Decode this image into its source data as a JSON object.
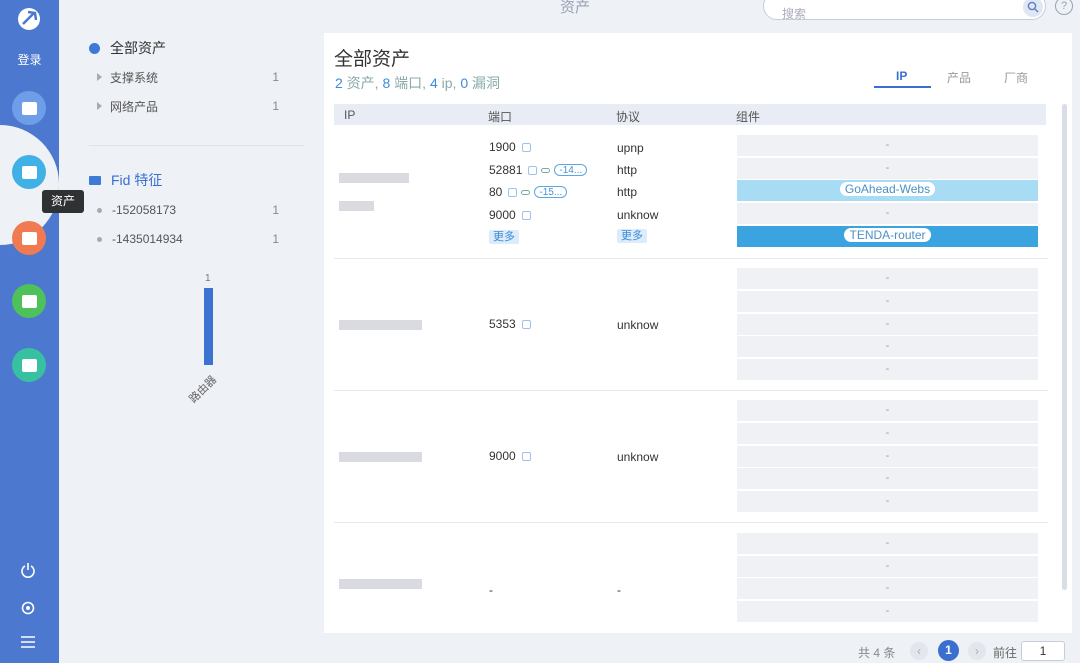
{
  "rail": {
    "login_label": "登录",
    "tooltip": "资产",
    "items": [
      {
        "name": "dashboard",
        "color": "#6f9ee8"
      },
      {
        "name": "assets",
        "color": "#3fb1e6"
      },
      {
        "name": "report",
        "color": "#f07a52"
      },
      {
        "name": "chart",
        "color": "#4fc15a"
      },
      {
        "name": "plugin",
        "color": "#38c1a0"
      }
    ]
  },
  "topbar": {
    "title": "资产",
    "search_placeholder": "搜索",
    "help": "?"
  },
  "tree": {
    "all_assets": "全部资产",
    "sections": [
      {
        "label": "支撑系统",
        "count": "1"
      },
      {
        "label": "网络产品",
        "count": "1"
      }
    ],
    "fid_title": "Fid 特征",
    "fids": [
      {
        "label": "-152058173",
        "count": "1"
      },
      {
        "label": "-1435014934",
        "count": "1"
      }
    ]
  },
  "chart_data": {
    "type": "bar",
    "categories": [
      "路由器"
    ],
    "values": [
      1
    ],
    "data_labels": [
      "1"
    ]
  },
  "panel": {
    "title": "全部资产",
    "stats": {
      "assets": "2",
      "assets_label": " 资产, ",
      "ports": "8",
      "ports_label": " 端口, ",
      "ips": "4",
      "ips_label": " ip, ",
      "vulns": "0",
      "vulns_label": " 漏洞"
    },
    "tabs": [
      "IP",
      "产品",
      "厂商"
    ],
    "columns": [
      "IP",
      "端口",
      "协议",
      "组件"
    ],
    "groups": [
      {
        "ports": [
          {
            "port": "1900",
            "link": false,
            "pill": ""
          },
          {
            "port": "52881",
            "link": true,
            "pill": "-14..."
          },
          {
            "port": "80",
            "link": true,
            "pill": "-15..."
          },
          {
            "port": "9000",
            "link": false,
            "pill": ""
          }
        ],
        "protocols": [
          "upnp",
          "http",
          "http",
          "unknow"
        ],
        "more_port": "更多",
        "more_proto": "更多",
        "components": [
          "-",
          "-",
          "GoAhead-Webs",
          "-",
          "TENDA-router"
        ]
      },
      {
        "ports": [
          {
            "port": "5353"
          }
        ],
        "protocols": [
          "unknow"
        ],
        "components": [
          "-",
          "-",
          "-",
          "-",
          "-"
        ]
      },
      {
        "ports": [
          {
            "port": "9000"
          }
        ],
        "protocols": [
          "unknow"
        ],
        "components": [
          "-",
          "-",
          "-",
          "-",
          "-"
        ]
      },
      {
        "ports": [
          {
            "port": "-"
          }
        ],
        "protocols": [
          "-"
        ],
        "components": [
          "-",
          "-",
          "-",
          "-"
        ]
      }
    ]
  },
  "pagination": {
    "total": "共 4 条",
    "current": "1",
    "goto_label": "前往",
    "goto_value": "1"
  }
}
